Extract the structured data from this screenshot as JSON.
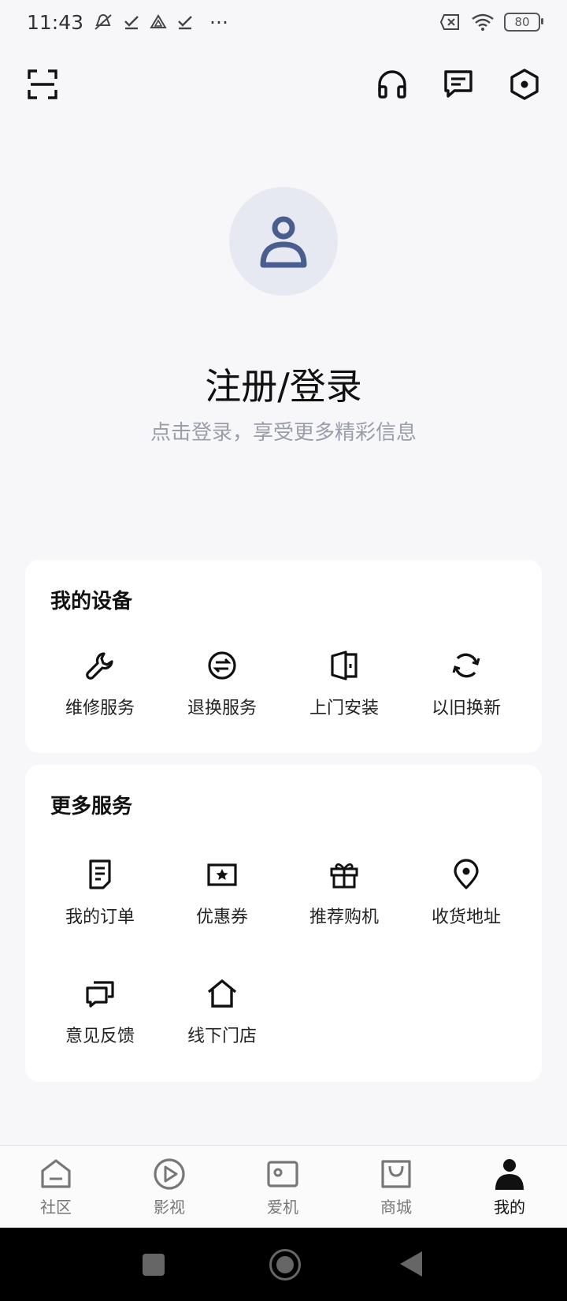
{
  "status": {
    "time": "11:43",
    "dots": "···",
    "battery": "80"
  },
  "icons": {
    "scan": "scan-icon",
    "headset": "headset-icon",
    "message": "message-icon",
    "settings": "settings-icon"
  },
  "login": {
    "title": "注册/登录",
    "subtitle": "点击登录，享受更多精彩信息"
  },
  "devices": {
    "title": "我的设备",
    "items": [
      {
        "label": "维修服务",
        "icon": "wrench-icon"
      },
      {
        "label": "退换服务",
        "icon": "exchange-icon"
      },
      {
        "label": "上门安装",
        "icon": "door-icon"
      },
      {
        "label": "以旧换新",
        "icon": "refresh-icon"
      }
    ]
  },
  "more": {
    "title": "更多服务",
    "items": [
      {
        "label": "我的订单",
        "icon": "order-icon"
      },
      {
        "label": "优惠券",
        "icon": "coupon-icon"
      },
      {
        "label": "推荐购机",
        "icon": "gift-icon"
      },
      {
        "label": "收货地址",
        "icon": "location-icon"
      },
      {
        "label": "意见反馈",
        "icon": "feedback-icon"
      },
      {
        "label": "线下门店",
        "icon": "store-icon"
      }
    ]
  },
  "tabs": [
    {
      "label": "社区",
      "icon": "community-icon"
    },
    {
      "label": "影视",
      "icon": "video-icon"
    },
    {
      "label": "爱机",
      "icon": "device-icon"
    },
    {
      "label": "商城",
      "icon": "shop-icon"
    },
    {
      "label": "我的",
      "icon": "profile-icon",
      "active": true
    }
  ],
  "colors": {
    "accent": "#4a5d8f",
    "avatar_bg": "#e6e9f1",
    "subtitle": "#9a9ea8"
  }
}
